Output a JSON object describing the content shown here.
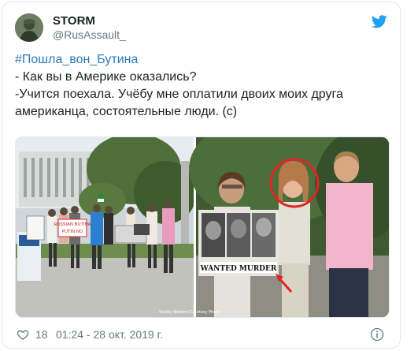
{
  "author": {
    "display_name": "STORM",
    "screen_name": "@RusAssault_",
    "avatar_icon": "avatar-image"
  },
  "tweet": {
    "hashtag": "#Пошла_вон_Бутина",
    "lines": [
      "- Как вы в Америке оказались?",
      "-Учится поехала. Учёбу мне оплатили двоих моих друга",
      "американца, состоятельные люди. (с)"
    ]
  },
  "media": {
    "left_photo": {
      "description_icon": "protest-photo",
      "signs": [
        "RUSSIAN BUTINA",
        "PUTIN NO"
      ],
      "credit": "Shelby Nelson (Courtesy Photo)"
    },
    "right_photo": {
      "description_icon": "protest-closeup-photo",
      "sign_text": "WANTED MURDER"
    }
  },
  "footer": {
    "like_count": "18",
    "timestamp": "01:24 - 28 окт. 2019 г.",
    "like_icon": "heart-icon",
    "info_icon": "info-icon"
  },
  "colors": {
    "link": "#2b7bb9",
    "twitter_blue": "#1da1f2",
    "secondary_text": "#697882",
    "highlight_circle": "#e0242a"
  }
}
